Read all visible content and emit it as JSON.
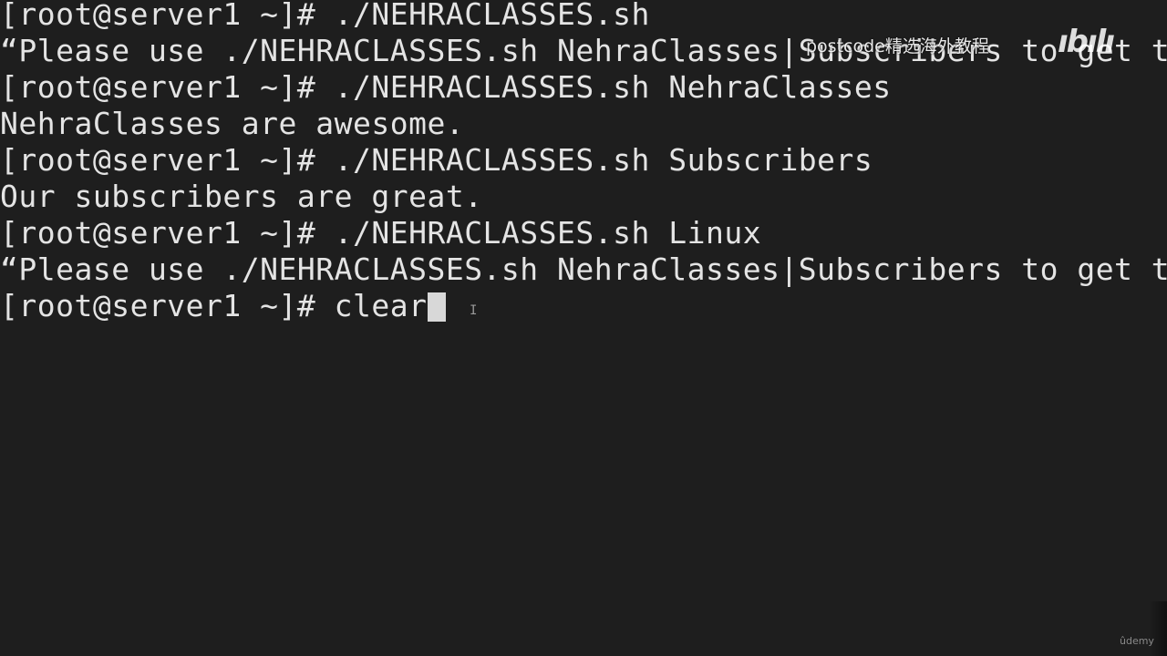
{
  "terminal": {
    "lines": [
      "[root@server1 ~]# ./NEHRACLASSES.sh",
      "“Please use ./NEHRACLASSES.sh NehraClasses|Subscribers to get t",
      "[root@server1 ~]# ./NEHRACLASSES.sh NehraClasses",
      "NehraClasses are awesome.",
      "[root@server1 ~]# ./NEHRACLASSES.sh Subscribers",
      "Our subscribers are great.",
      "[root@server1 ~]# ./NEHRACLASSES.sh Linux",
      "“Please use ./NEHRACLASSES.sh NehraClasses|Subscribers to get t"
    ],
    "current_prompt": "[root@server1 ~]# ",
    "current_input": "clear"
  },
  "overlays": {
    "watermark_text": "postcode精选海外教程",
    "logo_text": "bilibili",
    "brand_text": "ûdemy"
  }
}
